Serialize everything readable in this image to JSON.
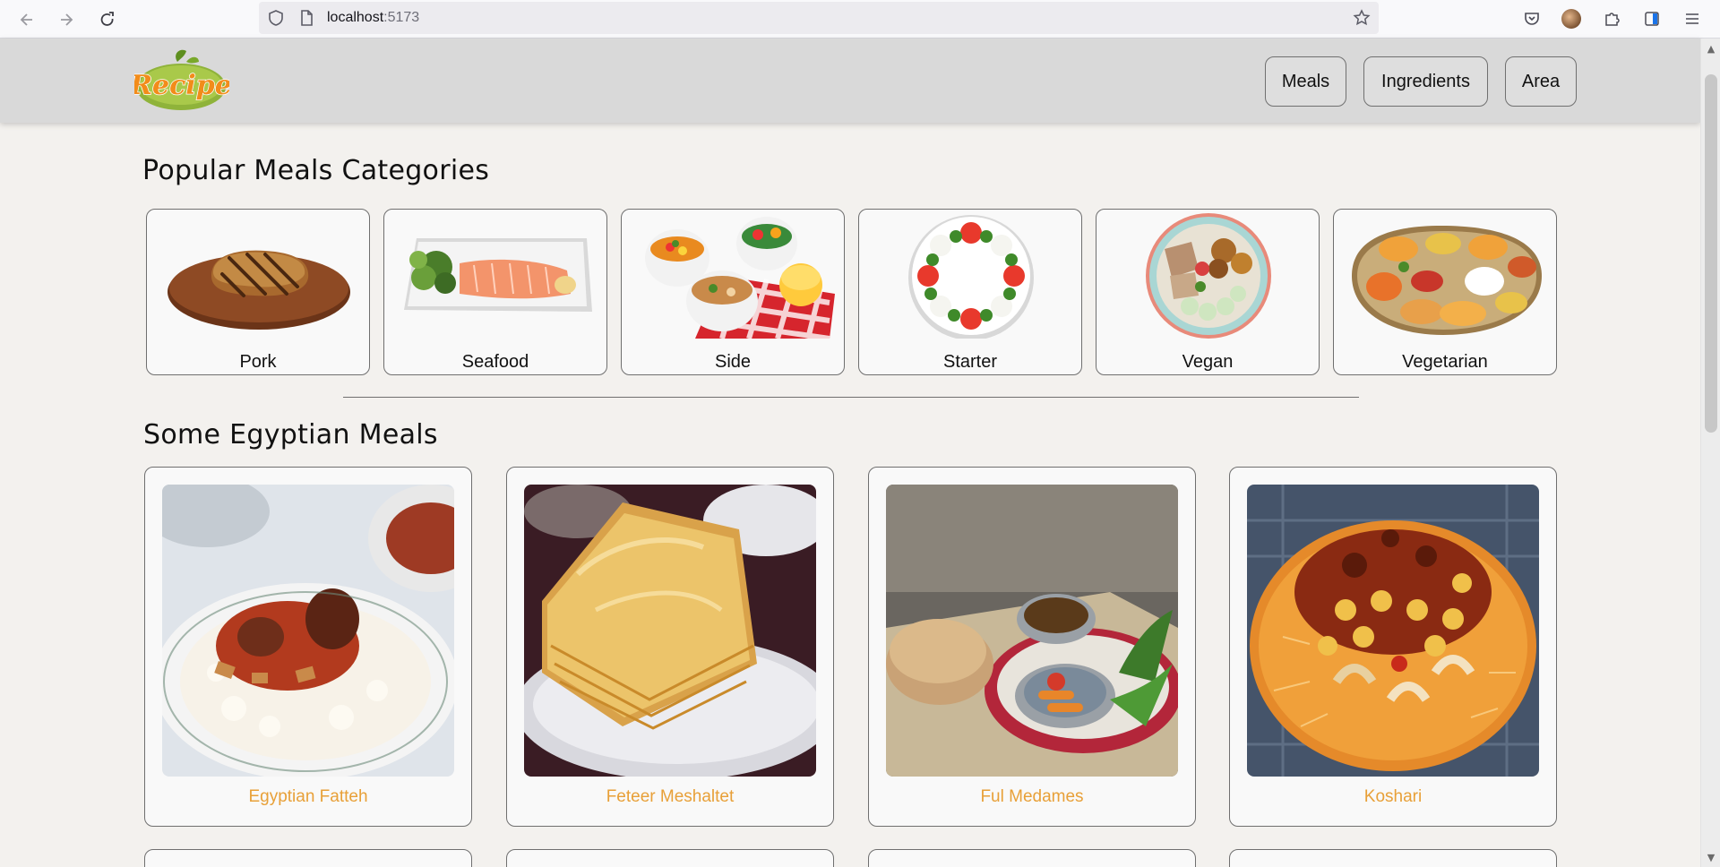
{
  "browser": {
    "url_host": "localhost",
    "url_port": ":5173",
    "icons": {
      "back": "back-arrow-icon",
      "forward": "forward-arrow-icon",
      "reload": "reload-icon",
      "tracking": "shield-icon",
      "page_info": "page-icon",
      "bookmark": "star-icon",
      "pocket": "pocket-icon",
      "account": "avatar",
      "extensions": "puzzle-icon",
      "sidebar": "sidebar-icon",
      "menu": "hamburger-menu-icon"
    }
  },
  "header": {
    "logo_text": "Recipe",
    "nav": [
      {
        "label": "Meals"
      },
      {
        "label": "Ingredients"
      },
      {
        "label": "Area"
      }
    ]
  },
  "categories_section": {
    "title": "Popular Meals Categories",
    "items": [
      {
        "label": "Pork"
      },
      {
        "label": "Seafood"
      },
      {
        "label": "Side"
      },
      {
        "label": "Starter"
      },
      {
        "label": "Vegan"
      },
      {
        "label": "Vegetarian"
      }
    ]
  },
  "meals_section": {
    "title": "Some Egyptian Meals",
    "items": [
      {
        "label": "Egyptian Fatteh"
      },
      {
        "label": "Feteer Meshaltet"
      },
      {
        "label": "Ful Medames"
      },
      {
        "label": "Koshari"
      }
    ]
  },
  "colors": {
    "meal_label": "#e8a038",
    "header_bg": "#d9d9d9",
    "page_bg": "#f3f1ee"
  }
}
